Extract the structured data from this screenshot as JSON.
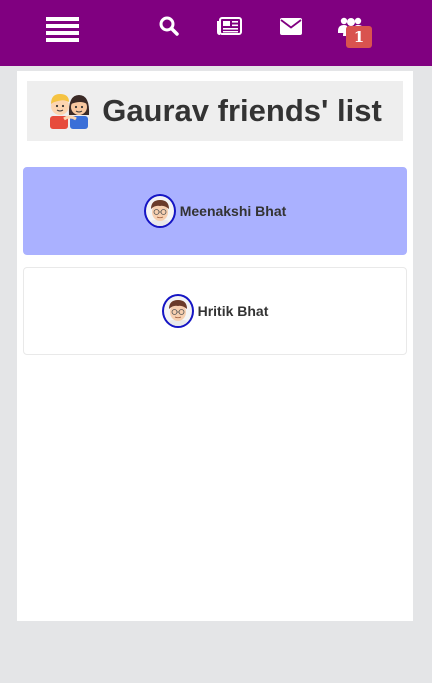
{
  "nav": {
    "menu_icon": "hamburger-menu-icon",
    "icons": [
      "search-icon",
      "newspaper-icon",
      "envelope-icon",
      "friends-icon"
    ],
    "friend_requests_badge": "1",
    "bar_color": "#800080",
    "badge_color": "#d9534f"
  },
  "header": {
    "title": "Gaurav friends' list",
    "icon": "friends-couple-icon"
  },
  "friends": [
    {
      "name": "Meenakshi Bhat",
      "highlighted": true,
      "highlight_color": "#aab1ff"
    },
    {
      "name": "Hritik Bhat",
      "highlighted": false
    }
  ]
}
